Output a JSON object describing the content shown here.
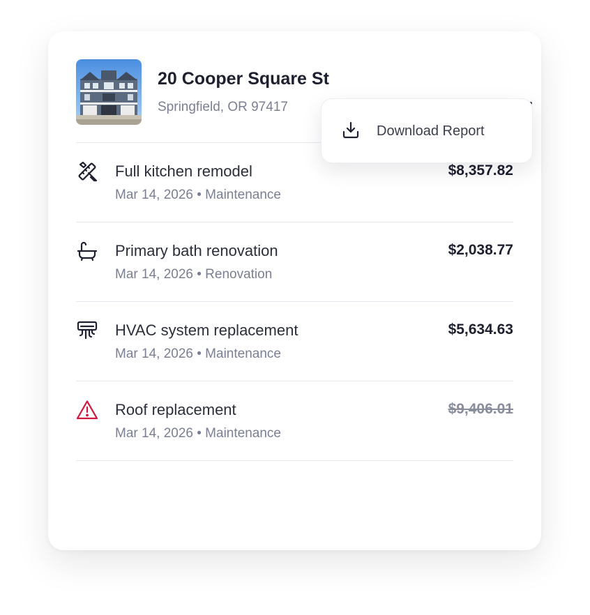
{
  "property": {
    "title": "20 Cooper Square St",
    "address": "Springfield, OR 97417",
    "thumbnail_icon": "house-photo"
  },
  "menu": {
    "trigger_icon": "kebab-menu-icon",
    "items": [
      {
        "label": "Download Report",
        "icon": "download-icon"
      }
    ]
  },
  "projects": [
    {
      "title": "Full kitchen remodel",
      "date": "Mar 14, 2026",
      "category": "Maintenance",
      "subtitle": "Mar 14, 2026 • Maintenance",
      "amount": "$8,357.82",
      "icon": "tools-icon",
      "struck": false
    },
    {
      "title": "Primary bath renovation",
      "date": "Mar 14, 2026",
      "category": "Renovation",
      "subtitle": "Mar 14, 2026 • Renovation",
      "amount": "$2,038.77",
      "icon": "bathtub-icon",
      "struck": false
    },
    {
      "title": "HVAC system replacement",
      "date": "Mar 14, 2026",
      "category": "Maintenance",
      "subtitle": "Mar 14, 2026 • Maintenance",
      "amount": "$5,634.63",
      "icon": "air-vent-icon",
      "struck": false
    },
    {
      "title": "Roof replacement",
      "date": "Mar 14, 2026",
      "category": "Maintenance",
      "subtitle": "Mar 14, 2026 • Maintenance",
      "amount": "$9,406.01",
      "icon": "warning-icon",
      "struck": true
    }
  ],
  "colors": {
    "title": "#1e2030",
    "muted": "#7a7f93",
    "warning": "#d1173d",
    "icon": "#1e2030"
  }
}
